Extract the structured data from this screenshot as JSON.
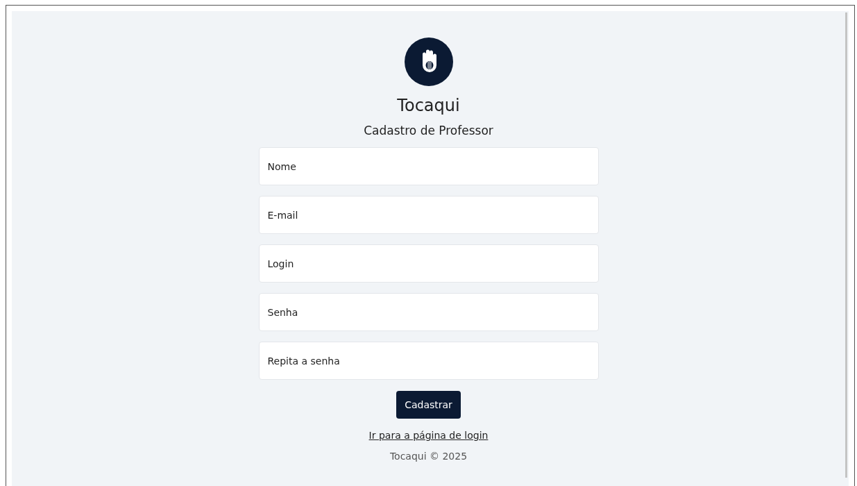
{
  "brand": {
    "name": "Tocaqui"
  },
  "form": {
    "title": "Cadastro de Professor",
    "fields": [
      {
        "placeholder": "Nome"
      },
      {
        "placeholder": "E-mail"
      },
      {
        "placeholder": "Login"
      },
      {
        "placeholder": "Senha"
      },
      {
        "placeholder": "Repita a senha"
      }
    ],
    "submit": "Cadastrar",
    "link": "Ir para a página de login"
  },
  "footer": "Tocaqui © 2025"
}
